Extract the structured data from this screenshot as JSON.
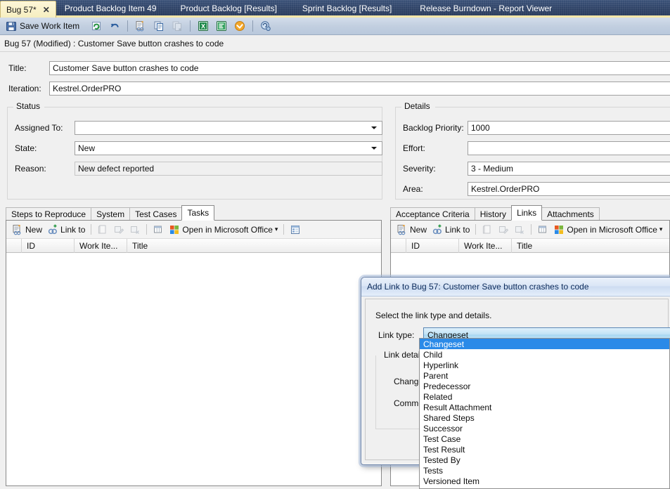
{
  "doc_tabs": [
    {
      "label": "Bug 57*",
      "active": true,
      "close_glyph": "✕"
    },
    {
      "label": "Product Backlog Item 49",
      "active": false
    },
    {
      "label": "Product Backlog [Results]",
      "active": false
    },
    {
      "label": "Sprint Backlog [Results]",
      "active": false
    },
    {
      "label": "Release Burndown - Report Viewer",
      "active": false
    }
  ],
  "toolbar": {
    "save_label": "Save Work Item",
    "icons": [
      "save-icon",
      "refresh-icon",
      "undo-icon",
      "new-linked-work-item-icon",
      "copy-work-item-icon",
      "create-copy-icon",
      "open-in-excel-icon",
      "open-in-project-icon",
      "open-in-outlook-icon",
      "work-item-options-icon"
    ]
  },
  "caption": "Bug 57 (Modified) : Customer Save button crashes to code",
  "form": {
    "title_label": "Title:",
    "title_value": "Customer Save button crashes to code",
    "iteration_label": "Iteration:",
    "iteration_value": "Kestrel.OrderPRO",
    "status_group": {
      "title": "Status",
      "fields": [
        {
          "label": "Assigned To:",
          "value": "",
          "type": "combo"
        },
        {
          "label": "State:",
          "value": "New",
          "type": "combo"
        },
        {
          "label": "Reason:",
          "value": "New defect reported",
          "type": "readonly"
        }
      ]
    },
    "details_group": {
      "title": "Details",
      "fields": [
        {
          "label": "Backlog Priority:",
          "value": "1000",
          "type": "text"
        },
        {
          "label": "Effort:",
          "value": "",
          "type": "text"
        },
        {
          "label": "Severity:",
          "value": "3 - Medium",
          "type": "text"
        },
        {
          "label": "Area:",
          "value": "Kestrel.OrderPRO",
          "type": "text"
        }
      ]
    }
  },
  "left_pane": {
    "tabs": [
      {
        "label": "Steps to Reproduce",
        "active": false
      },
      {
        "label": "System",
        "active": false
      },
      {
        "label": "Test Cases",
        "active": false
      },
      {
        "label": "Tasks",
        "active": true
      }
    ],
    "toolbar": {
      "new_label": "New",
      "link_to_label": "Link to",
      "office_label": "Open in Microsoft Office",
      "dropdown_glyph": "▾"
    },
    "grid_columns": [
      "",
      "ID",
      "Work Ite...",
      "Title"
    ],
    "rows": []
  },
  "right_pane": {
    "tabs": [
      {
        "label": "Acceptance Criteria",
        "active": false
      },
      {
        "label": "History",
        "active": false
      },
      {
        "label": "Links",
        "active": true
      },
      {
        "label": "Attachments",
        "active": false
      }
    ],
    "toolbar": {
      "new_label": "New",
      "link_to_label": "Link to",
      "office_label": "Open in Microsoft Office",
      "dropdown_glyph": "▾"
    },
    "grid_columns": [
      "",
      "ID",
      "Work Ite...",
      "Title"
    ],
    "rows": []
  },
  "dialog": {
    "title": "Add Link to Bug 57: Customer Save button crashes to code",
    "instruction": "Select the link type and details.",
    "link_type_label": "Link type:",
    "link_type_value": "Changeset",
    "link_details_group_title": "Link details",
    "changeset_label": "Changeset",
    "comment_label": "Comment",
    "options": [
      "Changeset",
      "Child",
      "Hyperlink",
      "Parent",
      "Predecessor",
      "Related",
      "Result Attachment",
      "Shared Steps",
      "Successor",
      "Test Case",
      "Test Result",
      "Tested By",
      "Tests",
      "Versioned Item"
    ],
    "selected_index": 0
  },
  "colors": {
    "tabstrip_bg": "#2f4367",
    "tabstrip_underline": "#f5e6a8",
    "active_doc_tab": "#fdf6d8",
    "toolbar_bg": "#c2cfe0",
    "form_bg": "#f0f0f0",
    "dropdown_highlight": "#2a8ae8",
    "dialog_caption": "#dbe6f6"
  }
}
